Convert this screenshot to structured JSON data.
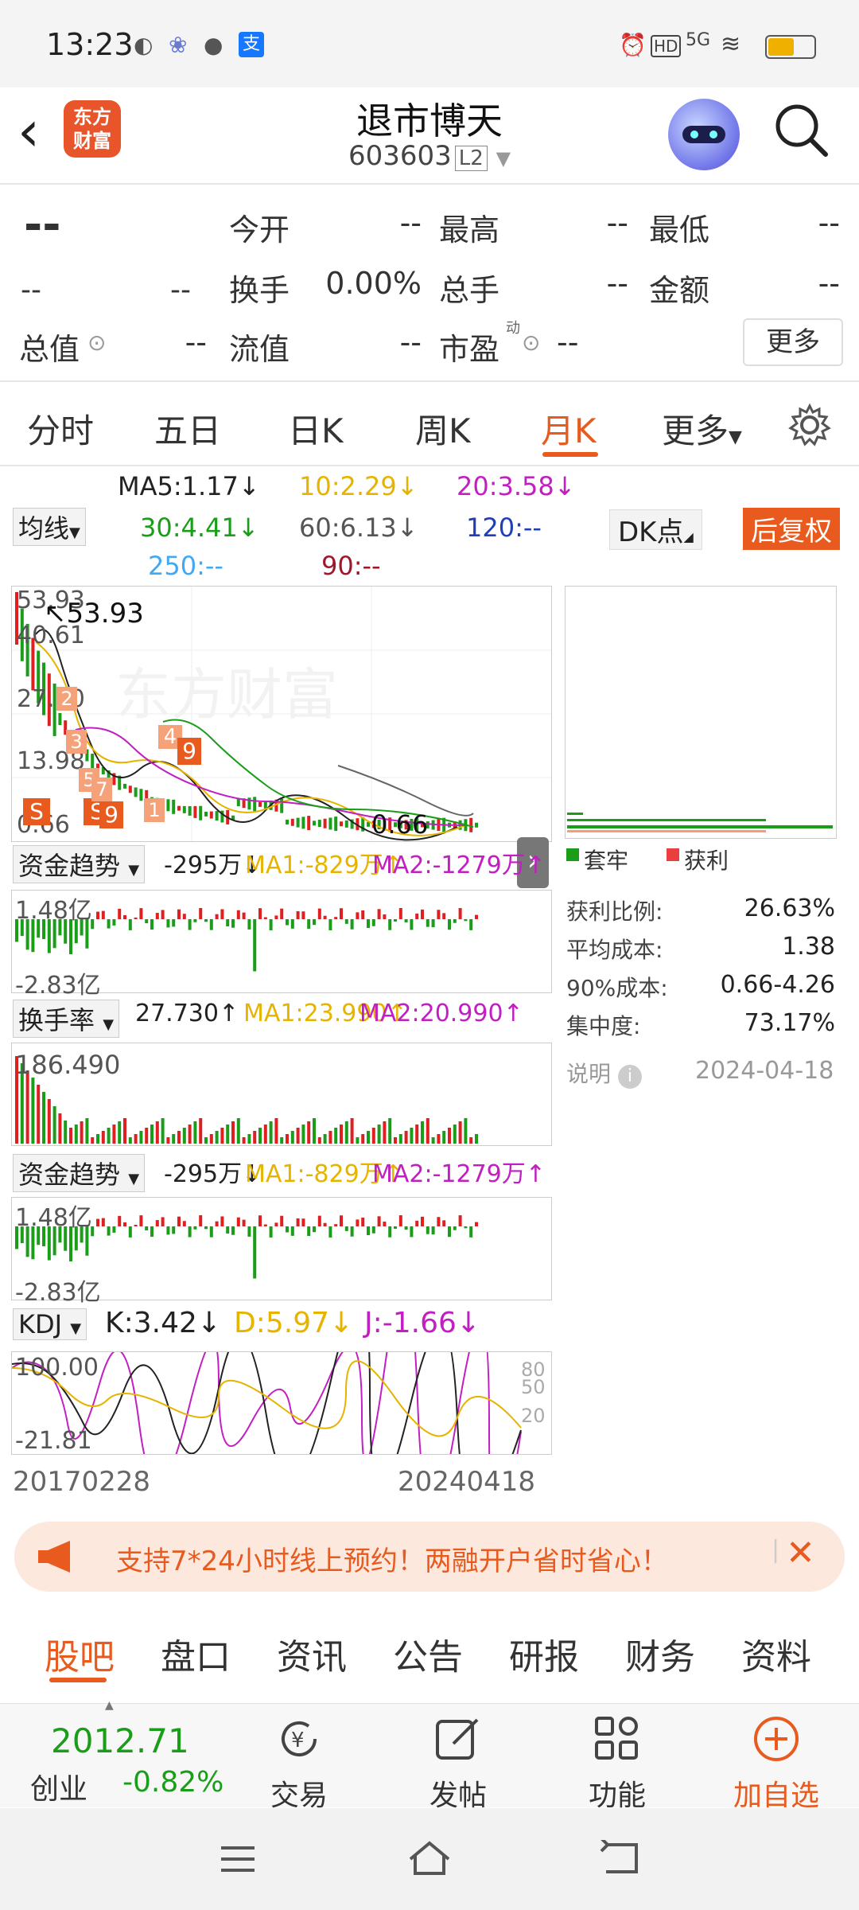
{
  "status_bar": {
    "time": "13:23",
    "network": "5G"
  },
  "header": {
    "logo_text": "东方\n财富",
    "title": "退市博天",
    "code": "603603",
    "level": "L2"
  },
  "quote": {
    "price": "--",
    "change": "--",
    "change_pct": "--",
    "fields": [
      {
        "label": "今开",
        "value": "--"
      },
      {
        "label": "最高",
        "value": "--"
      },
      {
        "label": "最低",
        "value": "--"
      },
      {
        "label": "换手",
        "value": "0.00%"
      },
      {
        "label": "总手",
        "value": "--"
      },
      {
        "label": "金额",
        "value": "--"
      },
      {
        "label": "总值",
        "value": "--"
      },
      {
        "label": "流值",
        "value": "--"
      },
      {
        "label": "市盈",
        "value": "--"
      }
    ],
    "pe_superscript": "动",
    "more_label": "更多"
  },
  "period_tabs": [
    "分时",
    "五日",
    "日K",
    "周K",
    "月K",
    "更多"
  ],
  "active_period": "月K",
  "ma_bar": {
    "selector": "均线",
    "ma5": "MA5:1.17↓",
    "ma10": "10:2.29↓",
    "ma20": "20:3.58↓",
    "ma30": "30:4.41↓",
    "ma60": "60:6.13↓",
    "ma120": "120:--",
    "ma250": "250:--",
    "ma90": "90:--",
    "dk_label": "DK点",
    "restore_label": "后复权"
  },
  "colors": {
    "accent": "#e85a1e",
    "up": "#e02020",
    "down": "#1a9e1a",
    "ma5": "#222222",
    "ma10": "#e6b400",
    "ma20": "#c21fc2",
    "ma30": "#1a9e1a",
    "ma60": "#666666",
    "ma120": "#1f3fb8",
    "ma250": "#3fa9f5",
    "ma90": "#a0162b"
  },
  "main_chart": {
    "max_label": "53.93",
    "y_labels": [
      "53.93",
      "40.61",
      "27.30",
      "13.98",
      "0.66"
    ],
    "min_label": "0.66",
    "watermark": "东方财富",
    "markers": [
      "S",
      "S",
      "4",
      "9",
      "9",
      "3",
      "5",
      "7",
      "2",
      "1"
    ]
  },
  "fund_trend_1": {
    "selector": "资金趋势",
    "value": "-295万↓",
    "ma1": "MA1:-829万↑",
    "ma2": "MA2:-1279万↑",
    "ymax": "1.48亿",
    "ymin": "-2.83亿"
  },
  "turnover": {
    "selector": "换手率",
    "value": "27.730↑",
    "ma1": "MA1:23.990↑",
    "ma2": "MA2:20.990↑",
    "ymax": "186.490"
  },
  "fund_trend_2": {
    "selector": "资金趋势",
    "value": "-295万↓",
    "ma1": "MA1:-829万↑",
    "ma2": "MA2:-1279万↑",
    "ymax": "1.48亿",
    "ymin": "-2.83亿"
  },
  "kdj": {
    "selector": "KDJ",
    "k": "K:3.42↓",
    "d": "D:5.97↓",
    "j": "J:-1.66↓",
    "ymax": "100.00",
    "ymin": "-21.81",
    "levels": [
      "80",
      "50",
      "20"
    ]
  },
  "x_axis": {
    "start": "20170228",
    "end": "20240418"
  },
  "chip_panel": {
    "legend_trapped": "套牢",
    "legend_profit": "获利",
    "rows": [
      {
        "label": "获利比例:",
        "value": "26.63%"
      },
      {
        "label": "平均成本:",
        "value": "1.38"
      },
      {
        "label": "90%成本:",
        "value": "0.66-4.26"
      },
      {
        "label": "集中度:",
        "value": "73.17%"
      }
    ],
    "note_label": "说明",
    "date": "2024-04-18"
  },
  "banner": {
    "text": "支持7*24小时线上预约！两融开户省时省心！"
  },
  "bottom_tabs": [
    "股吧",
    "盘口",
    "资讯",
    "公告",
    "研报",
    "财务",
    "资料"
  ],
  "active_bottom_tab": "股吧",
  "footer": {
    "index_value": "2012.71",
    "index_name": "创业",
    "index_change": "-0.82%",
    "buttons": [
      "交易",
      "发帖",
      "功能",
      "加自选"
    ]
  }
}
